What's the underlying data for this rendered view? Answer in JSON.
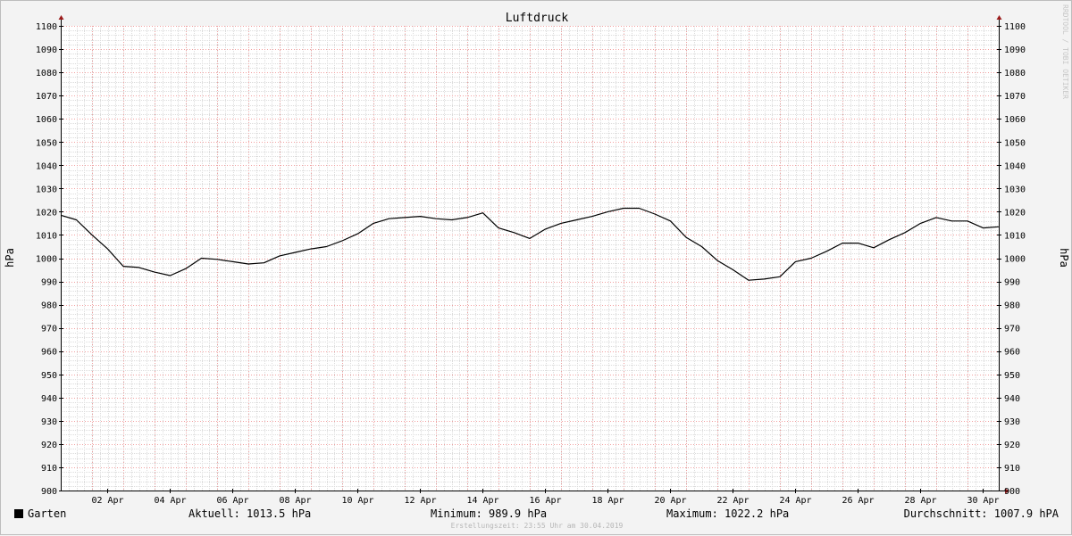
{
  "chart_data": {
    "type": "line",
    "title": "Luftdruck",
    "ylabel": "hPa",
    "ylabel_right": "hPa",
    "ylim": [
      900,
      1100
    ],
    "yticks": [
      900,
      910,
      920,
      930,
      940,
      950,
      960,
      970,
      980,
      990,
      1000,
      1010,
      1020,
      1030,
      1040,
      1050,
      1060,
      1070,
      1080,
      1090,
      1100
    ],
    "xlim": [
      "2019-04-01 00:00",
      "2019-04-30 23:55"
    ],
    "xticks": [
      "02 Apr",
      "04 Apr",
      "06 Apr",
      "08 Apr",
      "10 Apr",
      "12 Apr",
      "14 Apr",
      "16 Apr",
      "18 Apr",
      "20 Apr",
      "22 Apr",
      "24 Apr",
      "26 Apr",
      "28 Apr",
      "30 Apr"
    ],
    "grid": true,
    "series": [
      {
        "name": "Garten",
        "color": "#000000",
        "x": [
          "2019-04-01 00:00",
          "2019-04-01 12:00",
          "2019-04-02 00:00",
          "2019-04-02 12:00",
          "2019-04-03 00:00",
          "2019-04-03 12:00",
          "2019-04-04 00:00",
          "2019-04-04 12:00",
          "2019-04-05 00:00",
          "2019-04-05 12:00",
          "2019-04-06 00:00",
          "2019-04-06 12:00",
          "2019-04-07 00:00",
          "2019-04-07 12:00",
          "2019-04-08 00:00",
          "2019-04-08 12:00",
          "2019-04-09 00:00",
          "2019-04-09 12:00",
          "2019-04-10 00:00",
          "2019-04-10 12:00",
          "2019-04-11 00:00",
          "2019-04-11 12:00",
          "2019-04-12 00:00",
          "2019-04-12 12:00",
          "2019-04-13 00:00",
          "2019-04-13 12:00",
          "2019-04-14 00:00",
          "2019-04-14 12:00",
          "2019-04-15 00:00",
          "2019-04-15 12:00",
          "2019-04-16 00:00",
          "2019-04-16 12:00",
          "2019-04-17 00:00",
          "2019-04-17 12:00",
          "2019-04-18 00:00",
          "2019-04-18 12:00",
          "2019-04-19 00:00",
          "2019-04-19 12:00",
          "2019-04-20 00:00",
          "2019-04-20 12:00",
          "2019-04-21 00:00",
          "2019-04-21 12:00",
          "2019-04-22 00:00",
          "2019-04-22 12:00",
          "2019-04-23 00:00",
          "2019-04-23 12:00",
          "2019-04-24 00:00",
          "2019-04-24 12:00",
          "2019-04-25 00:00",
          "2019-04-25 12:00",
          "2019-04-26 00:00",
          "2019-04-26 12:00",
          "2019-04-27 00:00",
          "2019-04-27 12:00",
          "2019-04-28 00:00",
          "2019-04-28 12:00",
          "2019-04-29 00:00",
          "2019-04-29 12:00",
          "2019-04-30 00:00",
          "2019-04-30 12:00",
          "2019-04-30 23:55"
        ],
        "values": [
          1018.5,
          1016.5,
          1010,
          1004,
          996.5,
          996,
          994,
          992.5,
          995.5,
          1000,
          999.5,
          998.5,
          997.5,
          998,
          1001,
          1002.5,
          1004,
          1005,
          1007.5,
          1010.5,
          1015,
          1017,
          1017.5,
          1018,
          1017,
          1016.5,
          1017.5,
          1019.5,
          1013,
          1011,
          1008.5,
          1012.5,
          1015,
          1016.5,
          1018,
          1020,
          1021.5,
          1021.5,
          1019,
          1016,
          1009,
          1005,
          999,
          995,
          990.5,
          991,
          992,
          998.5,
          1000,
          1003,
          1006.5,
          1006.5,
          1004.5,
          1008,
          1011,
          1015,
          1017.5,
          1016,
          1016,
          1013,
          1013.5
        ]
      }
    ]
  },
  "legend": {
    "series_name": "Garten",
    "current": "Aktuell: 1013.5 hPa",
    "minimum": "Minimum: 989.9 hPa",
    "maximum": "Maximum: 1022.2 hPa",
    "average": "Durchschnitt: 1007.9 hPA"
  },
  "footer": "Erstellungszeit: 23:55 Uhr am 30.04.2019",
  "watermark": "RRDTOOL / TOBI OETIKER"
}
